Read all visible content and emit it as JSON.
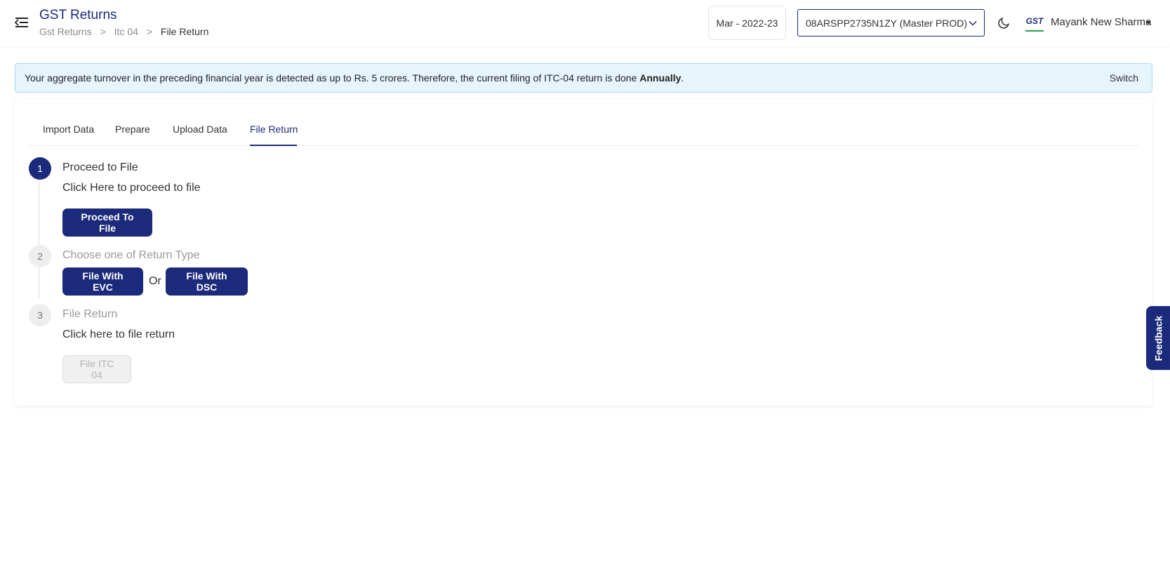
{
  "header": {
    "title": "GST Returns",
    "breadcrumb": [
      "Gst Returns",
      "Itc 04",
      "File Return"
    ],
    "breadcrumb_separator": ">",
    "period": "Mar - 2022-23",
    "gstin_selected": "08ARSPP2735N1ZY (Master PROD)",
    "logo_text": "GST",
    "user_name": "Mayank New Sharma"
  },
  "notice": {
    "text_before": "Your aggregate turnover in the preceding financial year is detected as up to Rs. 5 crores. Therefore, the current filing of ITC-04 return is done ",
    "text_bold": "Annually",
    "text_after": ".",
    "switch_label": "Switch"
  },
  "tabs": [
    {
      "label": "Import Data",
      "active": false
    },
    {
      "label": "Prepare",
      "active": false
    },
    {
      "label": "Upload Data",
      "active": false
    },
    {
      "label": "File Return",
      "active": true
    }
  ],
  "steps": [
    {
      "number": "1",
      "title": "Proceed to File",
      "description": "Click Here to proceed to file",
      "button": "Proceed To File",
      "state": "active"
    },
    {
      "number": "2",
      "title": "Choose one of Return Type",
      "button_evc": "File With EVC",
      "or_text": "Or",
      "button_dsc": "File With DSC",
      "state": "inactive"
    },
    {
      "number": "3",
      "title": "File Return",
      "description": "Click here to file return",
      "button": "File ITC 04",
      "state": "inactive"
    }
  ],
  "feedback_label": "Feedback",
  "colors": {
    "primary": "#1b2a7a",
    "notice_bg": "#e6f4fc",
    "notice_border": "#a9d7f0",
    "disabled_bg": "#f0f0f0"
  },
  "icons": [
    "menu-icon",
    "chevron-down-icon",
    "moon-icon",
    "caret-down-icon"
  ]
}
